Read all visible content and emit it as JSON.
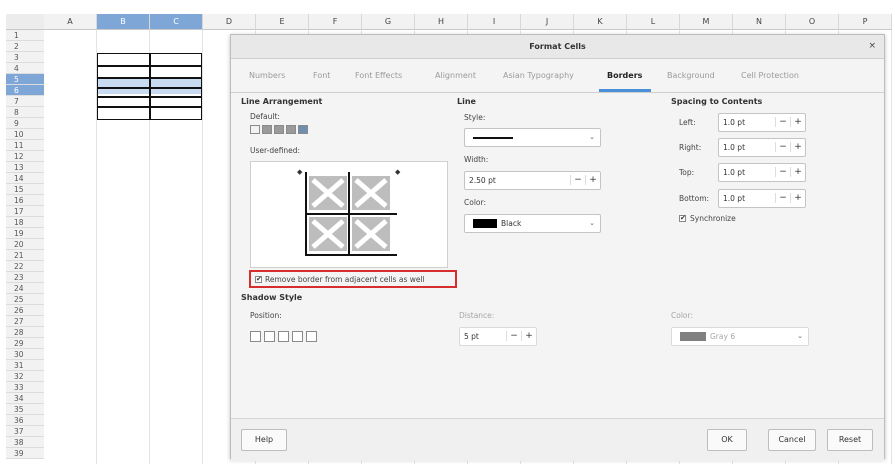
{
  "sheet": {
    "columns": [
      "A",
      "B",
      "C",
      "D",
      "E",
      "F",
      "G",
      "H",
      "I",
      "J",
      "K",
      "L",
      "M",
      "N",
      "O",
      "P"
    ],
    "rows": [
      "1",
      "2",
      "3",
      "4",
      "5",
      "6",
      "7",
      "8",
      "9",
      "10",
      "11",
      "12",
      "13",
      "14",
      "15",
      "16",
      "17",
      "18",
      "19",
      "20",
      "21",
      "22",
      "23",
      "24",
      "25",
      "26",
      "27",
      "28",
      "29",
      "30",
      "31",
      "32",
      "33",
      "34",
      "35",
      "36",
      "37",
      "38",
      "39"
    ]
  },
  "dialog": {
    "title": "Format Cells",
    "close": "×",
    "tabs": [
      "Numbers",
      "Font",
      "Font Effects",
      "Alignment",
      "Asian Typography",
      "Borders",
      "Background",
      "Cell Protection"
    ],
    "active_tab": "Borders"
  },
  "line_arrangement": {
    "header": "Line Arrangement",
    "default_label": "Default:",
    "user_defined_label": "User-defined:",
    "remove_border_label": "Remove border from adjacent cells as well",
    "remove_border_checked": true
  },
  "line": {
    "header": "Line",
    "style_label": "Style:",
    "width_label": "Width:",
    "width_value": "2.50 pt",
    "color_label": "Color:",
    "color_value": "Black",
    "color_hex": "#000000"
  },
  "spacing": {
    "header": "Spacing to Contents",
    "left_label": "Left:",
    "left_value": "1.0 pt",
    "right_label": "Right:",
    "right_value": "1.0 pt",
    "top_label": "Top:",
    "top_value": "1.0 pt",
    "bottom_label": "Bottom:",
    "bottom_value": "1.0 pt",
    "synchronize_label": "Synchronize",
    "synchronize_checked": true
  },
  "shadow": {
    "header": "Shadow Style",
    "position_label": "Position:",
    "distance_label": "Distance:",
    "distance_value": "5 pt",
    "color_label": "Color:",
    "color_value": "Gray 6",
    "color_hex": "#808080"
  },
  "spin": {
    "minus": "−",
    "plus": "+"
  },
  "checkmark": "✔",
  "buttons": {
    "help": "Help",
    "ok": "OK",
    "cancel": "Cancel",
    "reset": "Reset"
  },
  "colors": {
    "accent": "#4a90d9",
    "highlight": "#d62d2d",
    "selection": "#7ea7d8"
  }
}
